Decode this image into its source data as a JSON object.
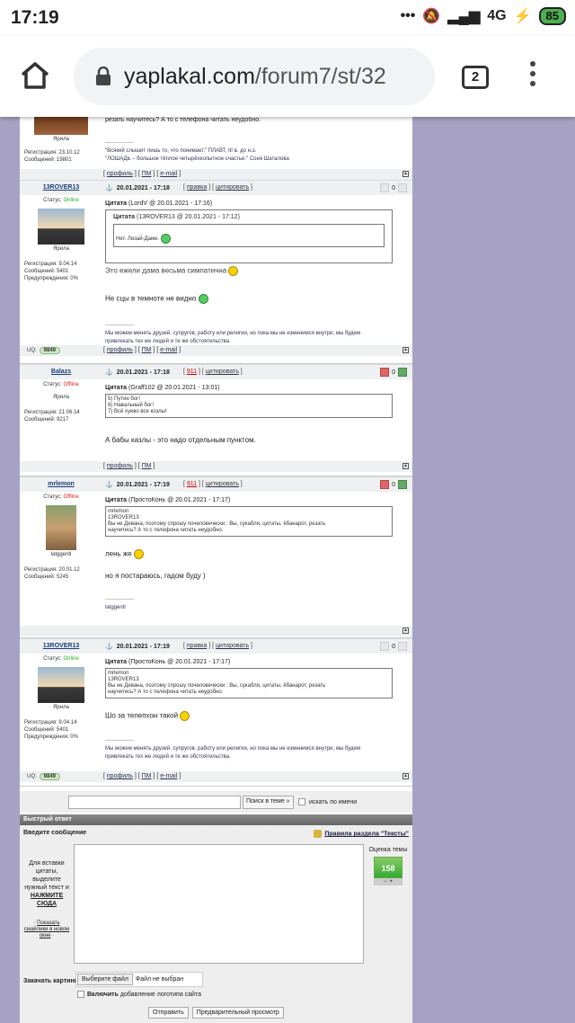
{
  "status_bar": {
    "time": "17:19",
    "signal": "4G",
    "battery": "85"
  },
  "browser": {
    "url_domain": "yaplakal.com",
    "url_path": "/forum7/st/32",
    "tab_count": "2"
  },
  "top_partial": {
    "text": "резать научитесь? А то с телефона читать неудобно.",
    "rank": "Ярила",
    "reg": "Регистрация: 23.10.12",
    "msgs": "Сообщений: 19801",
    "sig1": "\"Всякий слышит лишь то, что понимает.\" ПЛАВТ, III в. до н.э.",
    "sig2": "\"ЛОШАДЬ – большое тёплое четырёхкопытное счастье.\" Соня Шаталова",
    "sep": "----------------"
  },
  "links": {
    "profile": "профиль",
    "pm": "ПМ",
    "email": "e-mail",
    "edit": "правка",
    "quote": "цитировать",
    "n911": "911"
  },
  "posts": [
    {
      "nick": "13ROVER13",
      "date": "20.01.2021 - 17:18",
      "status_label": "Статус:",
      "status": "Online",
      "rank": "Ярила",
      "reg": "Регистрация: 9.04.14",
      "msgs": "Сообщений: 5401",
      "warn": "Предупреждения: 0%",
      "q_title": "Цитата",
      "q_src": "(LordV @ 20.01.2021 - 17:16)",
      "q2_title": "Цитата",
      "q2_src": "(13ROVER13 @ 20.01.2021 - 17:12)",
      "q2_text": "Нет. Лизай-Даме.",
      "q_text": "Это ежели дама весьма симпатична",
      "msg": "Не сцы в темноте не видно",
      "sig1": "Мы можем менять друзей, супругов, работу или религии, но пока мы не изменимся внутри, мы будем",
      "sig2": "привлекать тех же людей и те же обстоятельства.",
      "uq_label": "UQ:",
      "uq": "9849",
      "rating": "0"
    },
    {
      "nick": "Balazs",
      "date": "20.01.2021 - 17:18",
      "status_label": "Статус:",
      "status": "Offline",
      "rank": "Ярила",
      "reg": "Регистрация: 21.06.14",
      "msgs": "Сообщений: 9217",
      "q_title": "Цитата",
      "q_src": "(Graff102 @ 20.01.2021 - 13:01)",
      "q_l1": "5) Путин бог!",
      "q_l2": "6) Навальный бог!",
      "q_l3": "7) Всё хуево все козлы!",
      "msg": "А бабы казлы - это надо отдельным пунктом.",
      "rating": "0"
    },
    {
      "nick": "mrlemon",
      "date": "20.01.2021 - 17:19",
      "status_label": "Статус:",
      "status": "Offline",
      "rank": "latggentl",
      "reg": "Регистрация: 20.01.12",
      "msgs": "Сообщений: 5245",
      "q_title": "Цитата",
      "q_src": "(ПростоКонь @ 20.01.2021 - 17:17)",
      "q_l1": "mrlemon",
      "q_l2": "13ROVER13",
      "q_l3": "Вы не Девана, поэтому спрошу почеловечески : Вы, сукабля, цитаты, ёбанарот, резать",
      "q_l4": "научитесь? А то с телефона читать неудобно.",
      "msg": "лень же",
      "msg2": "но я постараюсь, гадом буду )",
      "sig": "latggentl",
      "rating": "0"
    },
    {
      "nick": "13ROVER13",
      "date": "20.01.2021 - 17:19",
      "status_label": "Статус:",
      "status": "Online",
      "rank": "Ярила",
      "reg": "Регистрация: 9.04.14",
      "msgs": "Сообщений: 5401",
      "warn": "Предупреждения: 0%",
      "q_title": "Цитата",
      "q_src": "(ПростоКонь @ 20.01.2021 - 17:17)",
      "q_l1": "mrlemon",
      "q_l2": "13ROVER13",
      "q_l3": "Вы не Девана, поэтому спрошу почеловечески : Вы, сукабля, цитаты, ёбанарот, резать",
      "q_l4": "научитесь? А то с телефона читать неудобно.",
      "msg": "Шо за телепхон такой",
      "sig1": "Мы можем менять друзей, супругов, работу или религии, но пока мы не изменимся внутри, мы будем",
      "sig2": "привлекать тех же людей и те же обстоятельства.",
      "uq_label": "UQ:",
      "uq": "9849",
      "rating": "0"
    }
  ],
  "search": {
    "button": "Поиск в теме »",
    "by_name": "искать по имени"
  },
  "quick_reply": {
    "title": "Быстрый ответ",
    "enter": "Введите сообщение",
    "rules": "Правила раздела \"Тексты\"",
    "help1": "Для вставки цитаты, выделите нужный текст и",
    "help_link": "НАЖМИТЕ СЮДА",
    "smiles": "Показать смайлики в новом окне",
    "rating_label": "Оценка темы",
    "rating": "158",
    "attach": "Закачать картинку:",
    "choose": "Выберите файл",
    "nofile": "Файл не выбран",
    "logo_b": "Включить",
    "logo_t": "добавление логотипа сайта",
    "send": "Отправить",
    "preview": "Предварительный просмотр"
  }
}
